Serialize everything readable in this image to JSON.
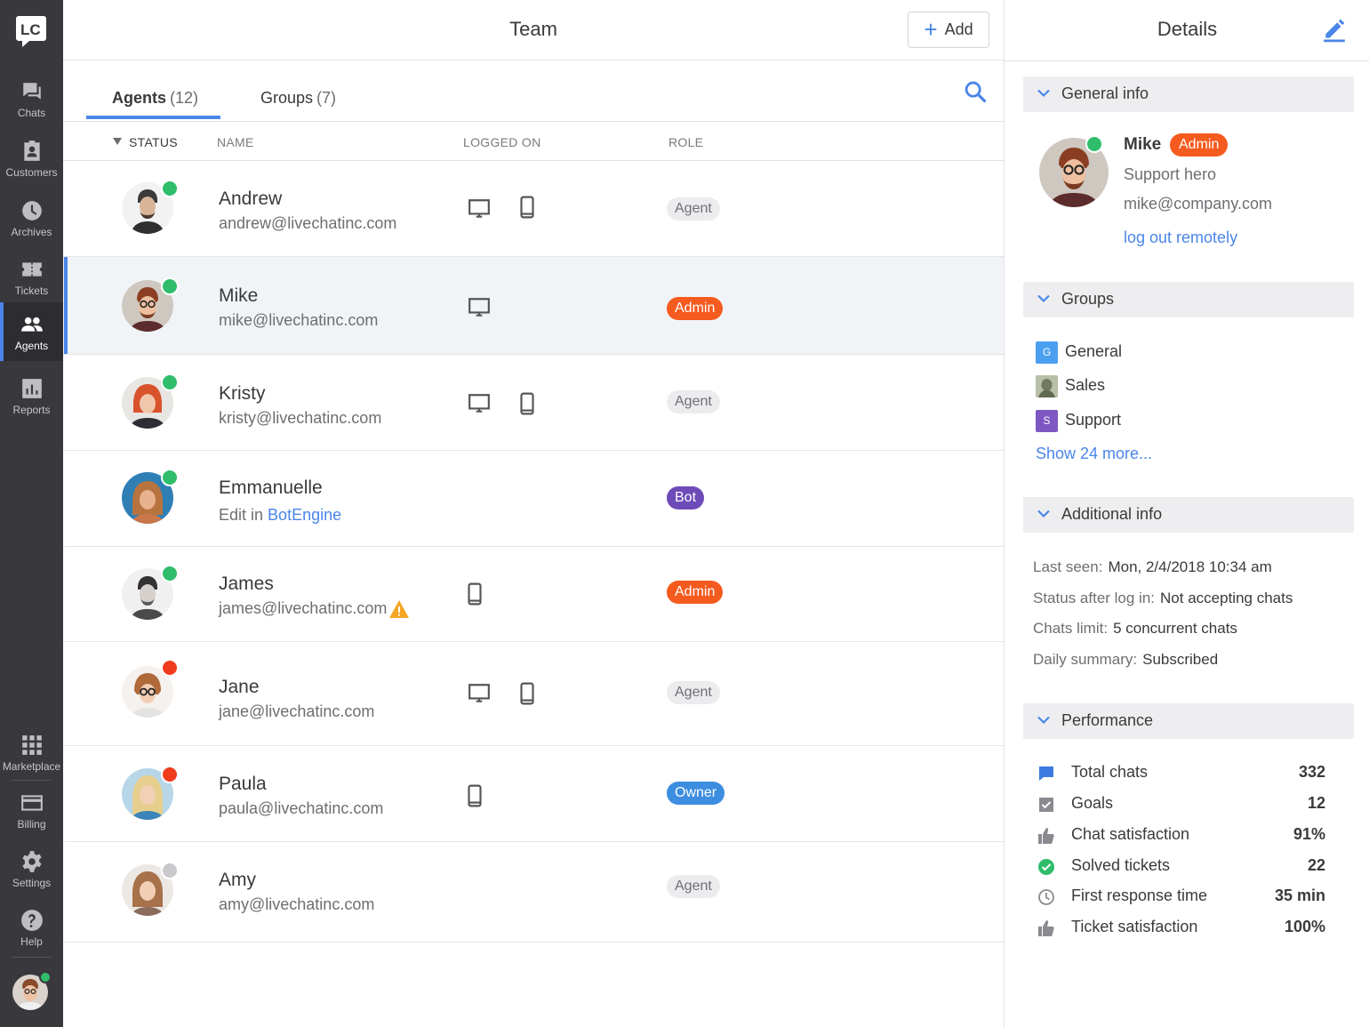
{
  "nav": {
    "items": [
      {
        "label": "Chats",
        "icon": "chat-icon"
      },
      {
        "label": "Customers",
        "icon": "customers-icon"
      },
      {
        "label": "Archives",
        "icon": "clock-icon"
      },
      {
        "label": "Tickets",
        "icon": "ticket-icon"
      },
      {
        "label": "Agents",
        "icon": "agents-icon"
      },
      {
        "label": "Reports",
        "icon": "reports-icon"
      }
    ],
    "bottom_items": [
      {
        "label": "Marketplace",
        "icon": "grid-icon"
      },
      {
        "label": "Billing",
        "icon": "card-icon"
      },
      {
        "label": "Settings",
        "icon": "gear-icon"
      },
      {
        "label": "Help",
        "icon": "help-icon"
      }
    ],
    "logo_text": "LC"
  },
  "header": {
    "title": "Team",
    "add_label": "Add"
  },
  "tabs": [
    {
      "label": "Agents",
      "count": "(12)"
    },
    {
      "label": "Groups",
      "count": "(7)"
    }
  ],
  "columns": {
    "status": "STATUS",
    "name": "NAME",
    "logged_on": "LOGGED ON",
    "role": "ROLE"
  },
  "agents": [
    {
      "name": "Andrew",
      "email": "andrew@livechatinc.com",
      "role": "Agent",
      "status_color": "#2fbd6b",
      "devices": [
        "desktop-icon",
        "mobile-icon"
      ]
    },
    {
      "name": "Mike",
      "email": "mike@livechatinc.com",
      "role": "Admin",
      "status_color": "#2fbd6b",
      "devices": [
        "desktop-icon"
      ]
    },
    {
      "name": "Kristy",
      "email": "kristy@livechatinc.com",
      "role": "Agent",
      "status_color": "#2fbd6b",
      "devices": [
        "desktop-icon",
        "mobile-icon"
      ]
    },
    {
      "name": "Emmanuelle",
      "email_prefix": "Edit in",
      "email_link": "BotEngine",
      "role": "Bot",
      "status_color": "#2fbd6b",
      "devices": []
    },
    {
      "name": "James",
      "email": "james@livechatinc.com",
      "role": "Admin",
      "status_color": "#2fbd6b",
      "devices": [
        "mobile-icon"
      ],
      "warning": "warning-icon"
    },
    {
      "name": "Jane",
      "email": "jane@livechatinc.com",
      "role": "Agent",
      "status_color": "#f03c1c",
      "devices": [
        "desktop-icon",
        "mobile-icon"
      ]
    },
    {
      "name": "Paula",
      "email": "paula@livechatinc.com",
      "role": "Owner",
      "status_color": "#f03c1c",
      "devices": [
        "mobile-icon"
      ]
    },
    {
      "name": "Amy",
      "email": "amy@livechatinc.com",
      "role": "Agent",
      "status_color": "#c9c9cc",
      "devices": []
    }
  ],
  "details": {
    "title": "Details",
    "general_info": {
      "header": "General info",
      "name": "Mike",
      "role": "Admin",
      "job_title": "Support hero",
      "email": "mike@company.com",
      "logout_link": "log out remotely"
    },
    "groups": {
      "header": "Groups",
      "items": [
        {
          "label": "General",
          "letter": "G",
          "color": "#4a9ff0"
        },
        {
          "label": "Sales",
          "letter": "",
          "color": "#8a9a7a"
        },
        {
          "label": "Support",
          "letter": "S",
          "color": "#7e57c2"
        }
      ],
      "show_more": "Show 24 more..."
    },
    "additional_info": {
      "header": "Additional info",
      "rows": [
        {
          "key": "Last seen:",
          "value": "Mon, 2/4/2018 10:34 am"
        },
        {
          "key": "Status after log in:",
          "value": "Not accepting chats"
        },
        {
          "key": "Chats limit:",
          "value": "5 concurrent chats"
        },
        {
          "key": "Daily summary:",
          "value": "Subscribed"
        }
      ]
    },
    "performance": {
      "header": "Performance",
      "rows": [
        {
          "label": "Total chats",
          "value": "332",
          "icon": "chat-bubble-icon"
        },
        {
          "label": "Goals",
          "value": "12",
          "icon": "checkbox-icon"
        },
        {
          "label": "Chat satisfaction",
          "value": "91%",
          "icon": "thumbs-up-icon"
        },
        {
          "label": "Solved tickets",
          "value": "22",
          "icon": "check-circle-icon"
        },
        {
          "label": "First response time",
          "value": "35 min",
          "icon": "clock-icon"
        },
        {
          "label": "Ticket satisfaction",
          "value": "100%",
          "icon": "thumbs-up-icon"
        }
      ]
    }
  },
  "colors": {
    "accent": "#4a86e8",
    "nav_bg": "#38383d",
    "admin": "#f55a1e",
    "bot": "#6d4bb8",
    "owner": "#3d8de0",
    "online": "#2fbd6b",
    "offline": "#f03c1c"
  }
}
